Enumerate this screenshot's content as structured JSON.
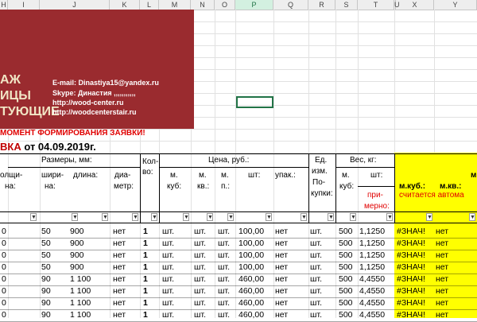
{
  "columns": [
    "H",
    "I",
    "J",
    "K",
    "L",
    "M",
    "N",
    "O",
    "P",
    "Q",
    "R",
    "S",
    "T",
    "U",
    "X",
    "Y"
  ],
  "banner": {
    "big_lines": [
      "АЖ",
      "ИЦЫ",
      "ТУЮЩИЕ"
    ],
    "email": "E-mail: Dinastiya15@yandex.ru",
    "skype": "Skype: Династия ,,,,,,,,,,,",
    "site1": "http://wood-center.ru",
    "site2": "http://woodcenterstair.ru",
    "color": "#9a2b2f"
  },
  "notice": "МОМЕНТ ФОРМИРОВАНИЯ ЗАЯВКИ!",
  "order": {
    "prefix": "ВКА",
    "date_text": " от 04.09.2019г."
  },
  "headers": {
    "sizes": "Размеры, мм:",
    "thickness": [
      "олщи-",
      "на:"
    ],
    "width": [
      "шири-",
      "на:"
    ],
    "length": "длина:",
    "diameter": [
      "диа-",
      "метр:"
    ],
    "qty": [
      "Кол-",
      "во:"
    ],
    "price": "Цена, руб.:",
    "m_cub": [
      "м.",
      "куб:"
    ],
    "m_kv": [
      "м.",
      "кв.:"
    ],
    "m_p": [
      "м.",
      "п.:"
    ],
    "pcs": "шт:",
    "pack": "упак.:",
    "unit": [
      "Ед.",
      "изм.",
      "По-",
      "купки:"
    ],
    "weight": "Вес, кг:",
    "w_mcub": [
      "м.",
      "куб:"
    ],
    "w_pcs": "шт:",
    "approx": [
      "при-",
      "мерно:"
    ],
    "auto": "считается автома",
    "y_mcub": "м.куб.:",
    "y_mkv": "м.кв.:",
    "y_last": "м"
  },
  "rows": [
    [
      "0",
      "50",
      "900",
      "нет",
      "1",
      "шт.",
      "шт.",
      "шт.",
      "100,00",
      "нет",
      "шт.",
      "500",
      "1,1250",
      "#ЗНАЧ!",
      "нет",
      "нет"
    ],
    [
      "0",
      "50",
      "900",
      "нет",
      "1",
      "шт.",
      "шт.",
      "шт.",
      "100,00",
      "нет",
      "шт.",
      "500",
      "1,1250",
      "#ЗНАЧ!",
      "нет",
      "нет"
    ],
    [
      "0",
      "50",
      "900",
      "нет",
      "1",
      "шт.",
      "шт.",
      "шт.",
      "100,00",
      "нет",
      "шт.",
      "500",
      "1,1250",
      "#ЗНАЧ!",
      "нет",
      "нет"
    ],
    [
      "0",
      "50",
      "900",
      "нет",
      "1",
      "шт.",
      "шт.",
      "шт.",
      "100,00",
      "нет",
      "шт.",
      "500",
      "1,1250",
      "#ЗНАЧ!",
      "нет",
      "нет"
    ],
    [
      "0",
      "90",
      "1 100",
      "нет",
      "1",
      "шт.",
      "шт.",
      "шт.",
      "460,00",
      "нет",
      "шт.",
      "500",
      "4,4550",
      "#ЗНАЧ!",
      "нет",
      "нет"
    ],
    [
      "0",
      "90",
      "1 100",
      "нет",
      "1",
      "шт.",
      "шт.",
      "шт.",
      "460,00",
      "нет",
      "шт.",
      "500",
      "4,4550",
      "#ЗНАЧ!",
      "нет",
      "нет"
    ],
    [
      "0",
      "90",
      "1 100",
      "нет",
      "1",
      "шт.",
      "шт.",
      "шт.",
      "460,00",
      "нет",
      "шт.",
      "500",
      "4,4550",
      "#ЗНАЧ!",
      "нет",
      "нет"
    ],
    [
      "0",
      "90",
      "1 100",
      "нет",
      "1",
      "шт.",
      "шт.",
      "шт.",
      "460,00",
      "нет",
      "шт.",
      "500",
      "4,4550",
      "#ЗНАЧ!",
      "нет",
      "нет"
    ]
  ],
  "filter_glyph": "▼",
  "accent_yellow": "#ffff00",
  "accent_red": "#e00000"
}
